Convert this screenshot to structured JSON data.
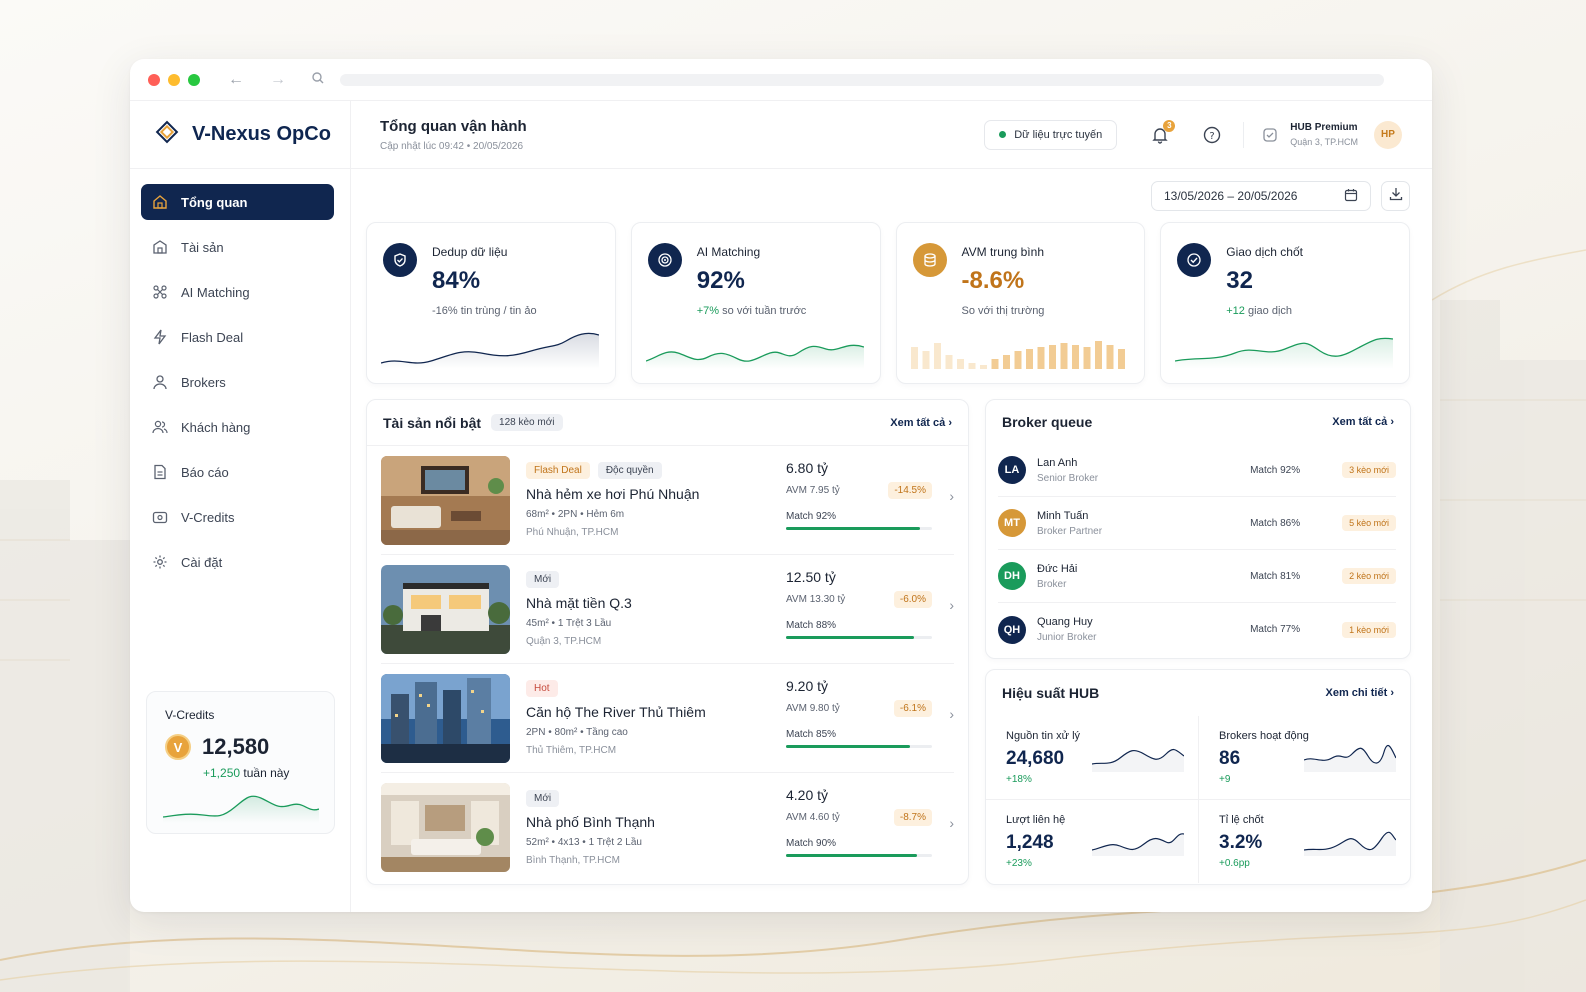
{
  "colors": {
    "navy": "#10264f",
    "accent": "#e8a33c",
    "green": "#1a9b5b",
    "orange": "#c0741a"
  },
  "brand": {
    "name": "V-Nexus OpCo",
    "logo_icon": "diamond-logo-icon"
  },
  "header": {
    "title": "Tổng quan vận hành",
    "subtitle": "Cập nhật lúc 09:42 • 20/05/2026",
    "live_status": "Dữ liệu trực tuyến",
    "notification_count": "3",
    "hub_name": "HUB Premium",
    "hub_location": "Quận 3, TP.HCM",
    "avatar_initials": "HP"
  },
  "sidebar": {
    "items": [
      {
        "label": "Tổng quan",
        "icon": "home-icon",
        "active": true
      },
      {
        "label": "Tài sản",
        "icon": "building-icon"
      },
      {
        "label": "AI Matching",
        "icon": "network-icon"
      },
      {
        "label": "Flash Deal",
        "icon": "bolt-icon"
      },
      {
        "label": "Brokers",
        "icon": "user-icon"
      },
      {
        "label": "Khách hàng",
        "icon": "users-icon"
      },
      {
        "label": "Báo cáo",
        "icon": "report-icon"
      },
      {
        "label": "V-Credits",
        "icon": "wallet-icon"
      },
      {
        "label": "Cài đặt",
        "icon": "gear-icon"
      }
    ],
    "credits": {
      "title": "V-Credits",
      "coin": "V",
      "value": "12,580",
      "delta": "+1,250",
      "delta_suffix": "tuần này"
    }
  },
  "date_range": "13/05/2026 – 20/05/2026",
  "kpis": [
    {
      "label": "Dedup dữ liệu",
      "value": "84%",
      "sub_highlight": "",
      "sub": "-16% tin trùng / tin ảo",
      "icon": "shield-icon"
    },
    {
      "label": "AI Matching",
      "value": "92%",
      "sub_highlight": "+7%",
      "sub": "so với tuần trước",
      "icon": "target-icon"
    },
    {
      "label": "AVM trung bình",
      "value": "-8.6%",
      "sub_highlight": "",
      "sub": "So với thị trường",
      "icon": "coins-icon"
    },
    {
      "label": "Giao dịch chốt",
      "value": "32",
      "sub_highlight": "+12",
      "sub": "giao dịch",
      "icon": "check-circle-icon"
    }
  ],
  "featured": {
    "title": "Tài sản nổi bật",
    "tag": "128 kèo mới",
    "link": "Xem tất cả",
    "items": [
      {
        "tags": [
          "Flash Deal",
          "Độc quyền"
        ],
        "name": "Nhà hẻm xe hơi Phú Nhuận",
        "meta": "68m²  •  2PN  •  Hẻm 6m",
        "location": "Phú Nhuận, TP.HCM",
        "price": "6.80 tỷ",
        "avm": "AVM 7.95 tỷ",
        "diff": "-14.5%",
        "match_label": "Match 92%",
        "match": 0.92
      },
      {
        "tags": [
          "Mới"
        ],
        "name": "Nhà mặt tiền Q.3",
        "meta": "45m²  •  1 Trệt 3 Lầu",
        "location": "Quận 3, TP.HCM",
        "price": "12.50 tỷ",
        "avm": "AVM 13.30 tỷ",
        "diff": "-6.0%",
        "match_label": "Match 88%",
        "match": 0.88
      },
      {
        "tags": [
          "Hot"
        ],
        "name": "Căn hộ The River Thủ Thiêm",
        "meta": "2PN  •  80m²  •  Tầng cao",
        "location": "Thủ Thiêm, TP.HCM",
        "price": "9.20 tỷ",
        "avm": "AVM 9.80 tỷ",
        "diff": "-6.1%",
        "match_label": "Match 85%",
        "match": 0.85
      },
      {
        "tags": [
          "Mới"
        ],
        "name": "Nhà phố Bình Thạnh",
        "meta": "52m²  •  4x13  •  1 Trệt 2 Lầu",
        "location": "Bình Thạnh, TP.HCM",
        "price": "4.20 tỷ",
        "avm": "AVM 4.60 tỷ",
        "diff": "-8.7%",
        "match_label": "Match 90%",
        "match": 0.9
      }
    ]
  },
  "broker_queue": {
    "title": "Broker queue",
    "link": "Xem tất cả",
    "items": [
      {
        "initials": "LA",
        "name": "Lan Anh",
        "role": "Senior Broker",
        "match": "Match 92%",
        "deals": "3 kèo mới",
        "color": "#10264f"
      },
      {
        "initials": "MT",
        "name": "Minh Tuấn",
        "role": "Broker Partner",
        "match": "Match 86%",
        "deals": "5 kèo mới",
        "color": "#d69838"
      },
      {
        "initials": "DH",
        "name": "Đức Hải",
        "role": "Broker",
        "match": "Match 81%",
        "deals": "2 kèo mới",
        "color": "#1a9b5b"
      },
      {
        "initials": "QH",
        "name": "Quang Huy",
        "role": "Junior Broker",
        "match": "Match 77%",
        "deals": "1 kèo mới",
        "color": "#10264f"
      }
    ]
  },
  "hub_perf": {
    "title": "Hiệu suất HUB",
    "link": "Xem chi tiết",
    "cells": [
      {
        "label": "Nguồn tin xử lý",
        "value": "24,680",
        "delta": "+18%"
      },
      {
        "label": "Brokers hoạt động",
        "value": "86",
        "delta": "+9"
      },
      {
        "label": "Lượt liên hệ",
        "value": "1,248",
        "delta": "+23%"
      },
      {
        "label": "Tỉ lệ chốt",
        "value": "3.2%",
        "delta": "+0.6pp"
      }
    ]
  }
}
